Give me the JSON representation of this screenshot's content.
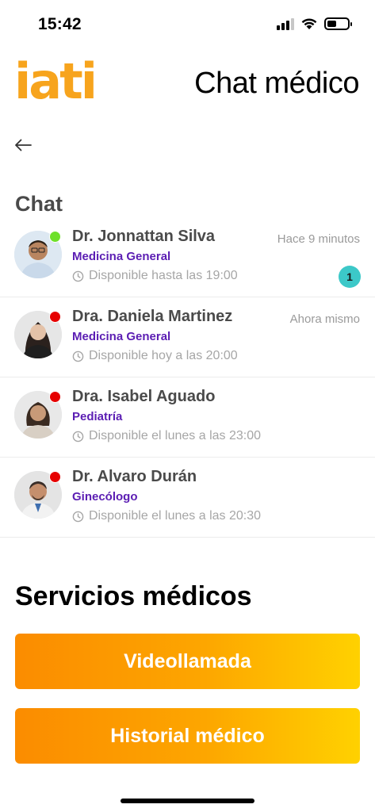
{
  "status_bar": {
    "time": "15:42"
  },
  "header": {
    "logo": "iati",
    "title": "Chat médico"
  },
  "chat_section": {
    "title": "Chat"
  },
  "chats": [
    {
      "name": "Dr. Jonnattan Silva",
      "specialty": "Medicina General",
      "availability": "Disponible hasta las 19:00",
      "timestamp": "Hace 9 minutos",
      "unread": "1",
      "status": "online",
      "status_color": "#6ee02a"
    },
    {
      "name": "Dra. Daniela Martinez",
      "specialty": "Medicina General",
      "availability": "Disponible hoy a las 20:00",
      "timestamp": "Ahora mismo",
      "status": "offline",
      "status_color": "#e60000"
    },
    {
      "name": "Dra. Isabel Aguado",
      "specialty": "Pediatría",
      "availability": "Disponible el lunes a las 23:00",
      "status": "offline",
      "status_color": "#e60000"
    },
    {
      "name": "Dr. Alvaro Durán",
      "specialty": "Ginecólogo",
      "availability": "Disponible el lunes a las 20:30",
      "status": "offline",
      "status_color": "#e60000"
    }
  ],
  "services": {
    "title": "Servicios médicos",
    "video_label": "Videollamada",
    "history_label": "Historial médico"
  },
  "colors": {
    "logo": "#f7a41d",
    "specialty": "#5b1db3",
    "badge": "#3cc8c8",
    "button_start": "#fb8c00",
    "button_end": "#ffd100"
  }
}
